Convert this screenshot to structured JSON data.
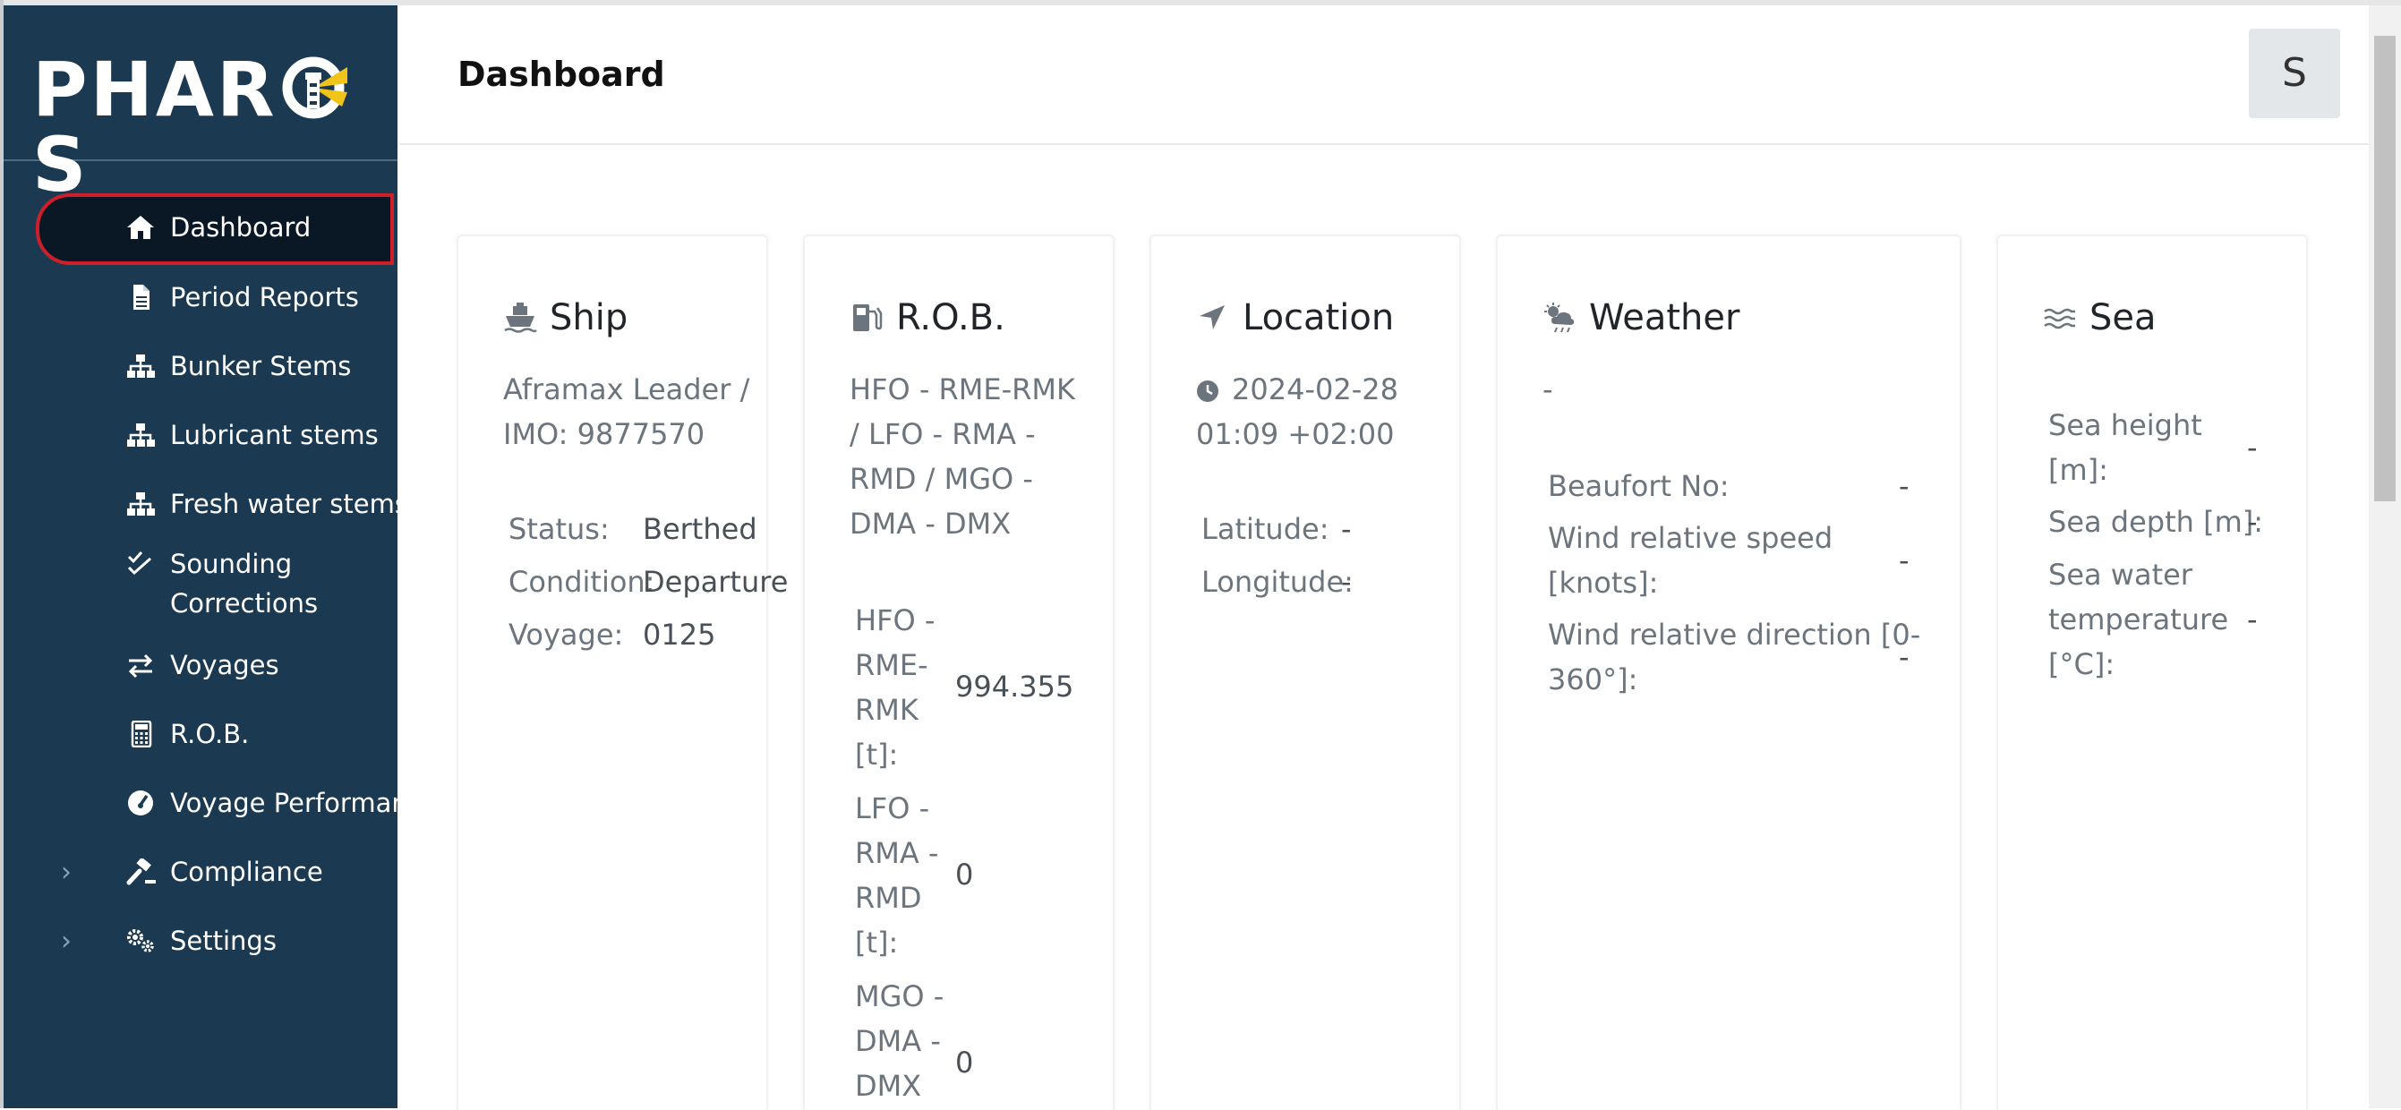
{
  "app": {
    "logo_text_left": "PHAR",
    "logo_text_right": "S"
  },
  "sidebar": {
    "items": [
      {
        "label": "Dashboard",
        "icon": "home-icon"
      },
      {
        "label": "Period Reports",
        "icon": "document-icon"
      },
      {
        "label": "Bunker Stems",
        "icon": "sitemap-icon"
      },
      {
        "label": "Lubricant stems",
        "icon": "sitemap-icon"
      },
      {
        "label": "Fresh water stems",
        "icon": "sitemap-icon"
      },
      {
        "label": "Sounding",
        "label2": "Corrections",
        "icon": "double-check-icon"
      },
      {
        "label": "Voyages",
        "icon": "swap-arrows-icon"
      },
      {
        "label": "R.O.B.",
        "icon": "calculator-icon"
      },
      {
        "label": "Voyage Performance",
        "icon": "gauge-icon"
      },
      {
        "label": "Compliance",
        "icon": "gavel-icon"
      },
      {
        "label": "Settings",
        "icon": "gears-icon"
      }
    ]
  },
  "header": {
    "title": "Dashboard",
    "user_initial": "S"
  },
  "cards": {
    "ship": {
      "title": "Ship",
      "name_line1": "Aframax Leader /",
      "name_line2": "IMO: 9877570",
      "status_label": "Status:",
      "status_value": "Berthed",
      "condition_label": "Condition:",
      "condition_value": "Departure",
      "voyage_label": "Voyage:",
      "voyage_value": "0125"
    },
    "rob": {
      "title": "R.O.B.",
      "desc_lines": [
        "HFO - RME-RMK",
        "/ LFO - RMA -",
        "RMD / MGO -",
        "DMA - DMX"
      ],
      "rows": [
        {
          "label_lines": [
            "HFO -",
            "RME-",
            "RMK",
            "[t]:"
          ],
          "value": "994.355"
        },
        {
          "label_lines": [
            "LFO -",
            "RMA -",
            "RMD",
            "[t]:"
          ],
          "value": "0"
        },
        {
          "label_lines": [
            "MGO -",
            "DMA -",
            "DMX"
          ],
          "value": "0"
        }
      ]
    },
    "location": {
      "title": "Location",
      "time_line1": "2024-02-28",
      "time_line2": "01:09 +02:00",
      "latitude_label": "Latitude:",
      "latitude_value": "-",
      "longitude_label": "Longitude:",
      "longitude_value": "-"
    },
    "weather": {
      "title": "Weather",
      "summary": "-",
      "beaufort_label": "Beaufort No:",
      "beaufort_value": "-",
      "wind_speed_label1": "Wind relative speed",
      "wind_speed_label2": "[knots]:",
      "wind_speed_value": "-",
      "wind_dir_label1": "Wind relative direction [0-",
      "wind_dir_label2": "360°]:",
      "wind_dir_value": "-"
    },
    "sea": {
      "title": "Sea",
      "height_label1": "Sea height",
      "height_label2": "[m]:",
      "height_value": "-",
      "depth_label": "Sea depth [m]:",
      "depth_value": "-",
      "temp_label1": "Sea water",
      "temp_label2": "temperature",
      "temp_label3": "[°C]:",
      "temp_value": "-"
    }
  },
  "colors": {
    "sidebar_bg": "#1b3a52",
    "active_bg": "#0a1724",
    "active_border": "#cc1f2a",
    "logo_accent": "#f2c318"
  }
}
